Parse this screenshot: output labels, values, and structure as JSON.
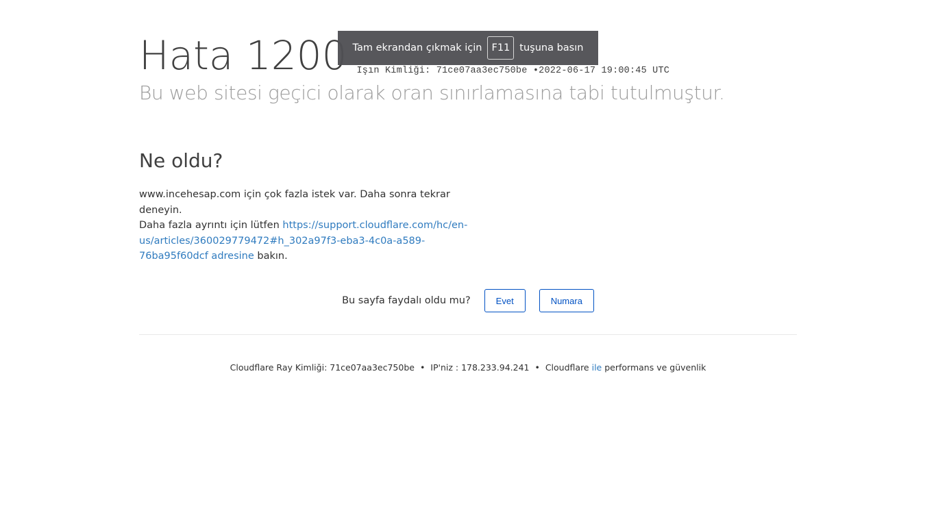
{
  "header": {
    "title": "Hata 1200",
    "ray_id_label": "Işın Kimliği: 71ce07aa3ec750be",
    "ray_sep": "•",
    "timestamp": "2022-06-17 19:00:45 UTC",
    "subtitle": "Bu web sitesi geçici olarak oran sınırlamasına tabi tutulmuştur."
  },
  "section": {
    "heading": "Ne oldu?",
    "line1": "www.incehesap.com için çok fazla istek var. Daha sonra tekrar deneyin.",
    "line2_prefix": "Daha fazla ayrıntı için lütfen ",
    "link_text": "https://support.cloudflare.com/hc/en-us/articles/360029779472#h_302a97f3-eba3-4c0a-a589-76ba95f60dcf adresine",
    "line2_suffix": " bakın."
  },
  "feedback": {
    "question": "Bu sayfa faydalı oldu mu?",
    "yes_label": "Evet",
    "no_label": "Numara"
  },
  "footer": {
    "ray_id": "Cloudflare Ray Kimliği: 71ce07aa3ec750be",
    "sep1": "•",
    "ip": "IP'niz : 178.233.94.241",
    "sep2": "•",
    "perf_prefix": "Cloudflare",
    "perf_link": "ile",
    "perf_suffix": "performans ve güvenlik"
  },
  "fullscreen_toast": {
    "prefix": "Tam ekrandan çıkmak için",
    "key": "F11",
    "suffix": "tuşuna basın"
  },
  "colors": {
    "link": "#2f7bbf",
    "button_border": "#0051c3",
    "toast_bg": "#505054"
  }
}
